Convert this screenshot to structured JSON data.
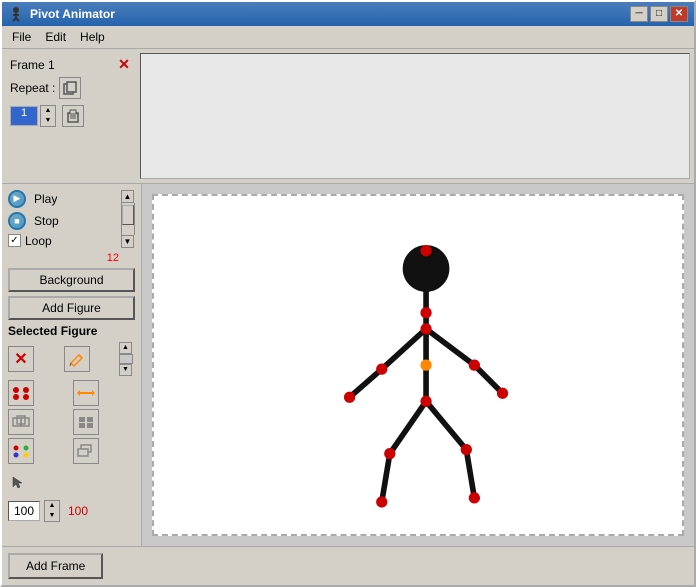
{
  "titleBar": {
    "title": "Pivot Animator",
    "minBtn": "─",
    "maxBtn": "□",
    "closeBtn": "✕"
  },
  "menu": {
    "items": [
      "File",
      "Edit",
      "Help"
    ]
  },
  "topPanel": {
    "frameTitle": "Frame 1",
    "repeatLabel": "Repeat :"
  },
  "leftPanel": {
    "playLabel": "Play",
    "stopLabel": "Stop",
    "loopLabel": "Loop",
    "fps": "12",
    "backgroundLabel": "Background",
    "addFigureLabel": "Add Figure",
    "selectedFigureLabel": "Selected Figure"
  },
  "bottomBar": {
    "addFrameLabel": "Add Frame",
    "sizeValue": "100",
    "sizeValue2": "100"
  },
  "canvas": {
    "bgColor": "#ffffff"
  }
}
